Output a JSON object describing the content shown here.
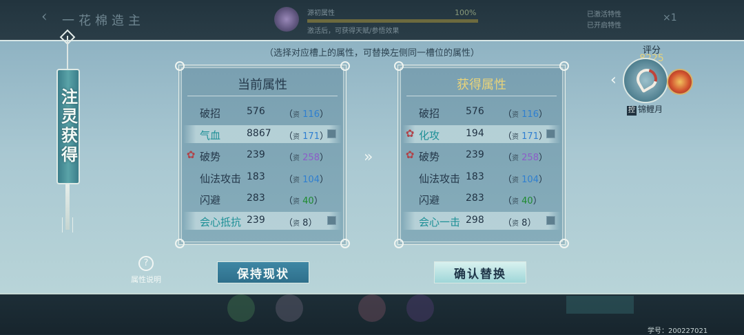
{
  "top_bar": {
    "back_glyph": "‹",
    "title": "一花棉造主",
    "activity_name": "源初属性",
    "activity_desc": "激活后，可获得天赋/参悟效果",
    "progress_text": "100%",
    "progress_value": 1.0,
    "right_top": "已激活特性",
    "right_sub": "已开启特性",
    "x_count": "×1"
  },
  "hint": "（选择对应槽上的属性，可替换左侧同一槽位的属性）",
  "scroll_label": "注灵获得",
  "current_panel": {
    "title": "当前属性",
    "rows": [
      {
        "name": "破招",
        "value": "576",
        "qual_prefix": "资",
        "qual": "116",
        "qual_color": "blue",
        "highlight": false,
        "lock": false,
        "mark": false,
        "teal": false
      },
      {
        "name": "气血",
        "value": "8867",
        "qual_prefix": "资",
        "qual": "171",
        "qual_color": "blue",
        "highlight": true,
        "lock": true,
        "mark": false,
        "teal": true
      },
      {
        "name": "破势",
        "value": "239",
        "qual_prefix": "资",
        "qual": "258",
        "qual_color": "purple",
        "highlight": false,
        "lock": false,
        "mark": true,
        "teal": false
      },
      {
        "name": "仙法攻击",
        "value": "183",
        "qual_prefix": "资",
        "qual": "104",
        "qual_color": "blue",
        "highlight": false,
        "lock": false,
        "mark": false,
        "teal": false
      },
      {
        "name": "闪避",
        "value": "283",
        "qual_prefix": "资",
        "qual": "40",
        "qual_color": "green",
        "highlight": false,
        "lock": false,
        "mark": false,
        "teal": false
      },
      {
        "name": "会心抵抗",
        "value": "239",
        "qual_prefix": "资",
        "qual": "8",
        "qual_color": "plain",
        "highlight": true,
        "lock": true,
        "mark": false,
        "teal": true
      }
    ]
  },
  "gain_panel": {
    "title": "获得属性",
    "rows": [
      {
        "name": "破招",
        "value": "576",
        "qual_prefix": "资",
        "qual": "116",
        "qual_color": "blue",
        "highlight": false,
        "lock": false,
        "mark": false,
        "teal": false
      },
      {
        "name": "化攻",
        "value": "194",
        "qual_prefix": "资",
        "qual": "171",
        "qual_color": "blue",
        "highlight": true,
        "lock": true,
        "mark": true,
        "teal": true
      },
      {
        "name": "破势",
        "value": "239",
        "qual_prefix": "资",
        "qual": "258",
        "qual_color": "purple",
        "highlight": false,
        "lock": false,
        "mark": true,
        "teal": false
      },
      {
        "name": "仙法攻击",
        "value": "183",
        "qual_prefix": "资",
        "qual": "104",
        "qual_color": "blue",
        "highlight": false,
        "lock": false,
        "mark": false,
        "teal": false
      },
      {
        "name": "闪避",
        "value": "283",
        "qual_prefix": "资",
        "qual": "40",
        "qual_color": "green",
        "highlight": false,
        "lock": false,
        "mark": false,
        "teal": false
      },
      {
        "name": "会心一击",
        "value": "298",
        "qual_prefix": "资",
        "qual": "8",
        "qual_color": "plain",
        "highlight": true,
        "lock": true,
        "mark": false,
        "teal": true
      }
    ]
  },
  "arrow_glyph": "»",
  "buttons": {
    "keep": "保持现状",
    "confirm": "确认替换"
  },
  "help": {
    "icon_glyph": "?",
    "label": "属性说明"
  },
  "score": {
    "label": "评分",
    "value": "8225"
  },
  "pet": {
    "ctrl_badge": "控",
    "name": "锦鲤月",
    "left_arrow": "‹"
  },
  "student_id": "学号：200227021",
  "colors": {
    "qual_blue": "#2f7fd0",
    "qual_purple": "#8c5cc9",
    "qual_green": "#1e8a2e",
    "gain_title": "#e8d37a",
    "score": "#e6d27a"
  }
}
